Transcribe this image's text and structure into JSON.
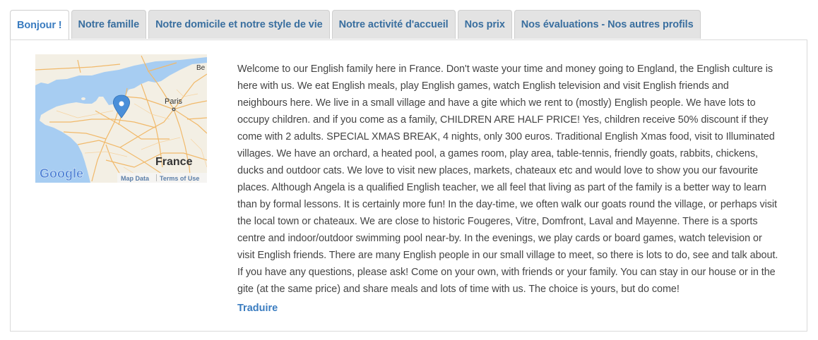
{
  "tabs": [
    {
      "label": "Bonjour !",
      "active": true
    },
    {
      "label": "Notre famille",
      "active": false
    },
    {
      "label": "Notre domicile et notre style de vie",
      "active": false
    },
    {
      "label": "Notre activité d'accueil",
      "active": false
    },
    {
      "label": "Nos prix",
      "active": false
    },
    {
      "label": "Nos évaluations - Nos autres profils",
      "active": false
    }
  ],
  "map": {
    "city_label": "Paris",
    "country_label": "France",
    "edge_label": "Be",
    "google_logo": "Google",
    "map_data_link": "Map Data",
    "terms_link": "Terms of Use",
    "marker_icon": "map-pin-icon",
    "colors": {
      "water": "#a7cdf2",
      "land": "#f3efe4",
      "roads": "#f1b96a",
      "marker": "#4a8fd9"
    }
  },
  "description": "Welcome to our English family here in France. Don't waste your time and money going to England, the English culture is here with us. We eat English meals, play English games, watch English television and visit English friends and neighbours here. We live in a small village and have a gite which we rent to (mostly) English people. We have lots to occupy children. and if you come as a family, CHILDREN ARE HALF PRICE! Yes, children receive 50% discount if they come with 2 adults. SPECIAL XMAS BREAK, 4 nights, only 300 euros. Traditional English Xmas food, visit to Illuminated villages. We have an orchard, a heated pool, a games room, play area, table-tennis, friendly goats, rabbits, chickens, ducks and outdoor cats. We love to visit new places, markets, chateaux etc and would love to show you our favourite places. Although Angela is a qualified English teacher, we all feel that living as part of the family is a better way to learn than by formal lessons. It is certainly more fun! In the day-time, we often walk our goats round the village, or perhaps visit the local town or chateaux. We are close to historic Fougeres, Vitre, Domfront, Laval and Mayenne. There is a sports centre and indoor/outdoor swimming pool near-by. In the evenings, we play cards or board games, watch television or visit English friends. There are many English people in our small village to meet, so there is lots to do, see and talk about. If you have any questions, please ask! Come on your own, with friends or your family. You can stay in our house or in the gite (at the same price) and share meals and lots of time with us. The choice is yours, but do come!",
  "translate_label": "Traduire",
  "colors": {
    "tab_text": "#3a6f9f",
    "active_tab_text": "#3a7cc0",
    "link": "#3a7cc0"
  }
}
